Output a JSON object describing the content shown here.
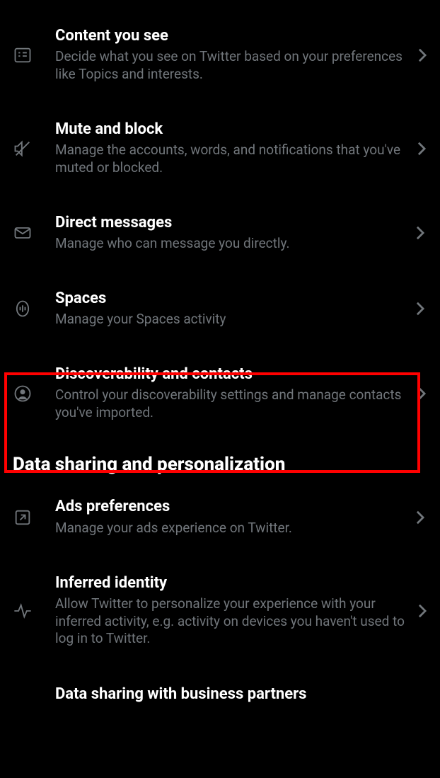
{
  "sections": [
    {
      "header": null,
      "items": [
        {
          "id": "content-you-see",
          "icon": "content-icon",
          "title": "Content you see",
          "desc": "Decide what you see on Twitter based on your preferences like Topics and interests."
        },
        {
          "id": "mute-and-block",
          "icon": "mute-icon",
          "title": "Mute and block",
          "desc": "Manage the accounts, words, and notifications that you've muted or blocked."
        },
        {
          "id": "direct-messages",
          "icon": "envelope-icon",
          "title": "Direct messages",
          "desc": "Manage who can message you directly."
        },
        {
          "id": "spaces",
          "icon": "spaces-icon",
          "title": "Spaces",
          "desc": "Manage your Spaces activity"
        },
        {
          "id": "discoverability",
          "icon": "person-circle-icon",
          "title": "Discoverability and contacts",
          "desc": "Control your discoverability settings and manage contacts you've imported.",
          "highlighted": true
        }
      ]
    },
    {
      "header": "Data sharing and personalization",
      "items": [
        {
          "id": "ads-preferences",
          "icon": "external-icon",
          "title": "Ads preferences",
          "desc": "Manage your ads experience on Twitter."
        },
        {
          "id": "inferred-identity",
          "icon": "activity-icon",
          "title": "Inferred identity",
          "desc": "Allow Twitter to personalize your experience with your inferred activity, e.g. activity on devices you haven't used to log in to Twitter."
        },
        {
          "id": "data-sharing-partners",
          "icon": "handshake-icon",
          "title": "Data sharing with business partners",
          "desc": ""
        }
      ]
    }
  ]
}
